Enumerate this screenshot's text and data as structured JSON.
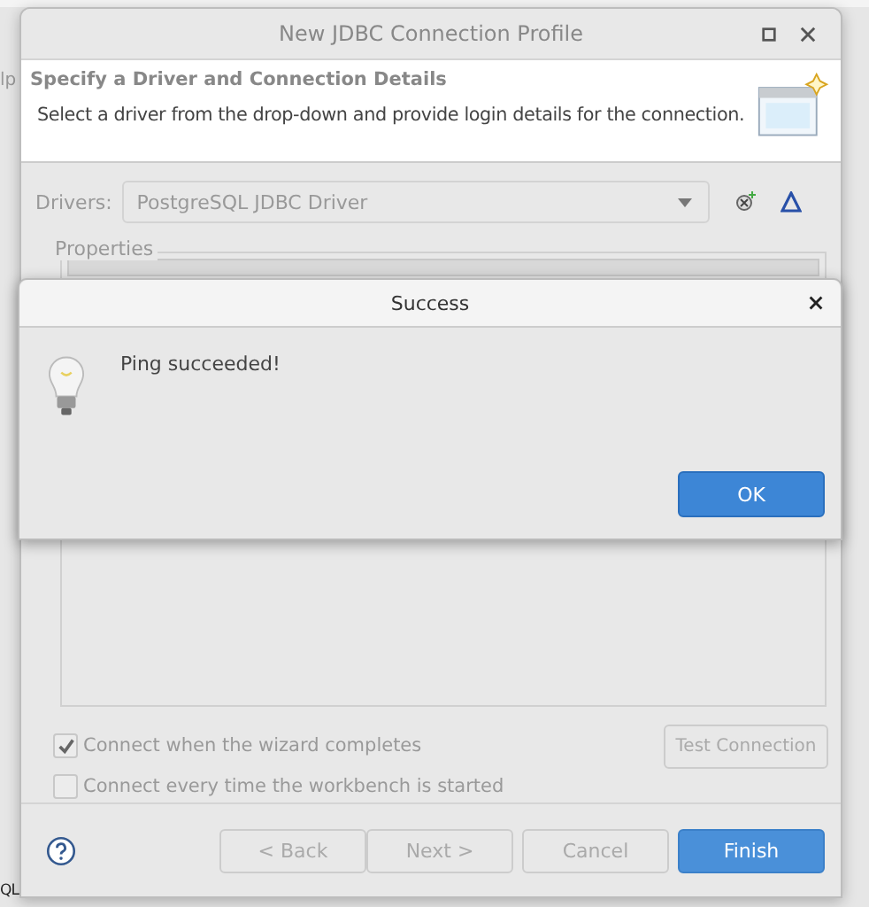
{
  "background_app": {
    "menu_fragment": "lp",
    "tab_fragment": "QL"
  },
  "wizard": {
    "title": "New JDBC Connection Profile",
    "heading": "Specify a Driver and Connection Details",
    "description": "Select a driver from the drop-down and provide login details for the connection.",
    "drivers": {
      "label": "Drivers:",
      "value": "PostgreSQL JDBC Driver"
    },
    "properties_label": "Properties",
    "options": [
      {
        "label": "Connect when the wizard completes",
        "checked": true
      },
      {
        "label": "Connect every time the workbench is started",
        "checked": false
      }
    ],
    "test_button": "Test Connection",
    "buttons": [
      {
        "label": "< Back",
        "primary": false
      },
      {
        "label": "Next >",
        "primary": false
      },
      {
        "label": "Cancel",
        "primary": false
      },
      {
        "label": "Finish",
        "primary": true
      }
    ]
  },
  "dialog": {
    "title": "Success",
    "message": "Ping succeeded!",
    "buttons": [
      "OK"
    ]
  }
}
